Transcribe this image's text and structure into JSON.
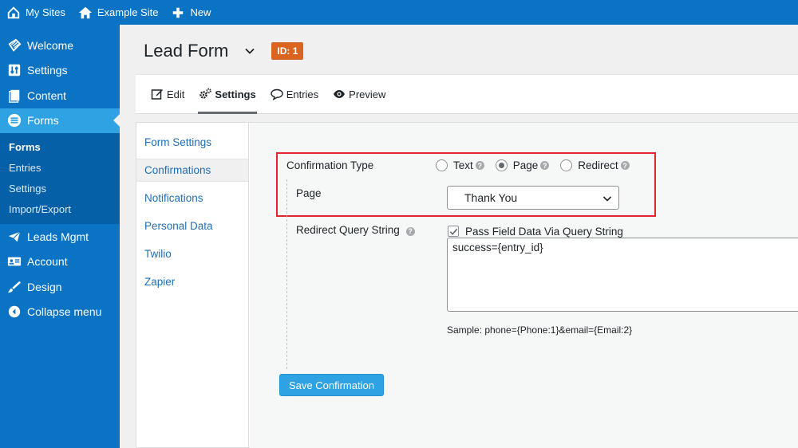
{
  "admin_bar": {
    "my_sites": "My Sites",
    "site_name": "Example Site",
    "new_label": "New"
  },
  "sidebar": {
    "items": [
      {
        "label": "Welcome",
        "icon": "welcome-icon"
      },
      {
        "label": "Settings",
        "icon": "settings-sliders-icon"
      },
      {
        "label": "Content",
        "icon": "content-pages-icon"
      },
      {
        "label": "Forms",
        "icon": "forms-icon"
      }
    ],
    "submenu": [
      "Forms",
      "Entries",
      "Settings",
      "Import/Export"
    ],
    "items_after": [
      {
        "label": "Leads Mgmt",
        "icon": "leads-envelope-icon"
      },
      {
        "label": "Account",
        "icon": "account-card-icon"
      },
      {
        "label": "Design",
        "icon": "design-brush-icon"
      },
      {
        "label": "Collapse menu",
        "icon": "collapse-arrow-icon"
      }
    ]
  },
  "header": {
    "form_title": "Lead Form",
    "id_badge": "ID: 1"
  },
  "tabs": {
    "edit": "Edit",
    "settings": "Settings",
    "entries": "Entries",
    "preview": "Preview"
  },
  "settings_nav": [
    "Form Settings",
    "Confirmations",
    "Notifications",
    "Personal Data",
    "Twilio",
    "Zapier"
  ],
  "confirmation": {
    "type_label": "Confirmation Type",
    "options": [
      "Text",
      "Page",
      "Redirect"
    ],
    "selected": "Page",
    "page_label": "Page",
    "page_value": "Thank You",
    "redirect_label": "Redirect Query String",
    "pass_label": "Pass Field Data Via Query String",
    "pass_checked": true,
    "query_value": "success={entry_id}",
    "sample": "Sample: phone={Phone:1}&email={Email:2}",
    "save_label": "Save Confirmation"
  },
  "colors": {
    "admin_blue": "#0a73c4",
    "active_blue": "#2ea2e3",
    "badge_orange": "#d86420",
    "highlight_red": "#e3262d",
    "link_blue": "#1f6fb5"
  }
}
